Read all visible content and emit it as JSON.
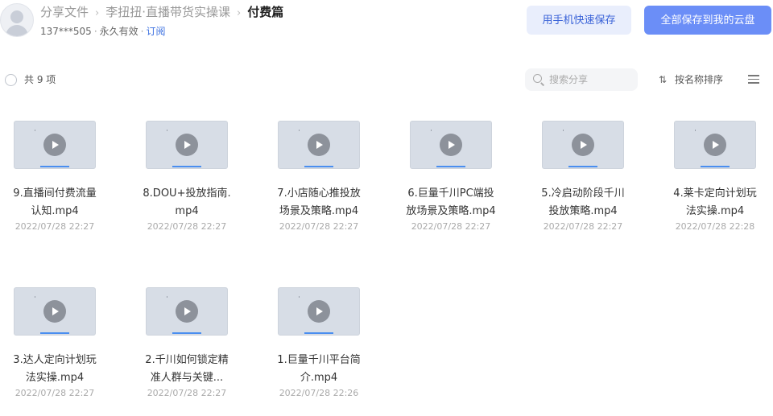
{
  "breadcrumb": {
    "items": [
      "分享文件",
      "李扭扭·直播带货实操课"
    ],
    "current": "付费篇",
    "separator": "›"
  },
  "share_info": {
    "user": "137***505",
    "validity": "永久有效",
    "subscribe": "订阅"
  },
  "actions": {
    "phone_save": "用手机快速保存",
    "save_all": "全部保存到我的云盘"
  },
  "toolbar": {
    "count": "共 9 项",
    "search_placeholder": "搜索分享",
    "sort_label": "按名称排序"
  },
  "icons": {
    "avatar": "user-avatar-icon",
    "search": "search-icon",
    "sort": "sort-icon",
    "menu": "list-menu-icon",
    "file": "video-file-icon"
  },
  "colors": {
    "accent": "#6b8ef7",
    "secondary_bg": "#e9eefc",
    "link": "#3a6fe0"
  },
  "files": [
    {
      "name": "9.直播间付费流量认知.mp4",
      "date": "2022/07/28 22:27"
    },
    {
      "name": "8.DOU+投放指南.mp4",
      "date": "2022/07/28 22:27"
    },
    {
      "name": "7.小店随心推投放场景及策略.mp4",
      "date": "2022/07/28 22:27"
    },
    {
      "name": "6.巨量千川PC端投放场景及策略.mp4",
      "date": "2022/07/28 22:27"
    },
    {
      "name": "5.冷启动阶段千川投放策略.mp4",
      "date": "2022/07/28 22:27"
    },
    {
      "name": "4.莱卡定向计划玩法实操.mp4",
      "date": "2022/07/28 22:28"
    },
    {
      "name": "3.达人定向计划玩法实操.mp4",
      "date": "2022/07/28 22:27"
    },
    {
      "name": "2.千川如何锁定精准人群与关键...",
      "date": "2022/07/28 22:27"
    },
    {
      "name": "1.巨量千川平台简介.mp4",
      "date": "2022/07/28 22:26"
    }
  ]
}
